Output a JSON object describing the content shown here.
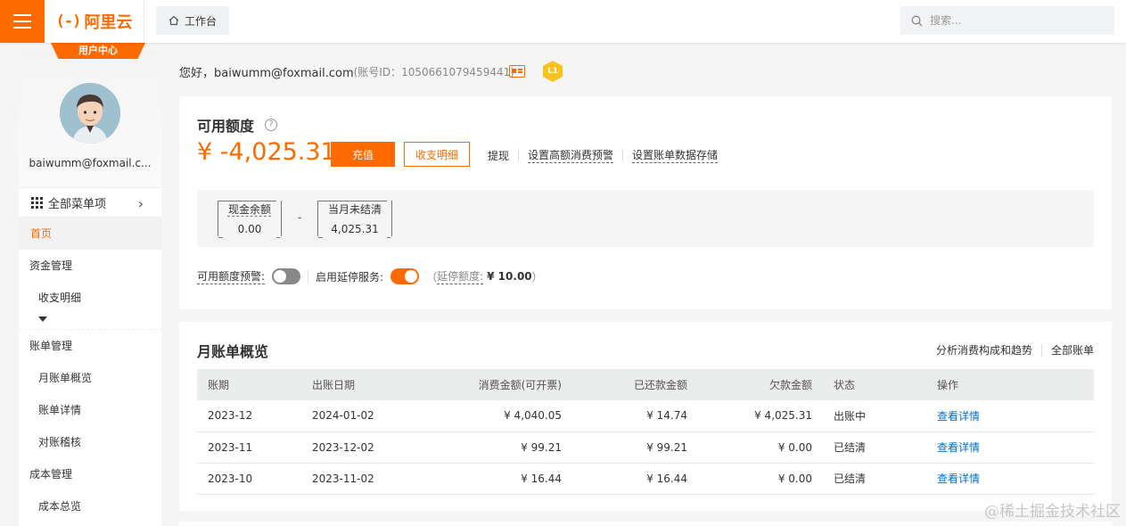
{
  "topbar": {
    "brand_mark": "(-)",
    "brand_name": "阿里云",
    "workbench_label": "工作台",
    "search_placeholder": "搜索..."
  },
  "sidebar": {
    "user_tag": "用户中心",
    "user_email": "baiwumm@foxmail.c...",
    "all_menu_label": "全部菜单项",
    "items": [
      {
        "type": "item",
        "label": "首页",
        "active": true
      },
      {
        "type": "group",
        "label": "资金管理"
      },
      {
        "type": "sub",
        "label": "收支明细"
      },
      {
        "type": "group",
        "label": "账单管理"
      },
      {
        "type": "sub",
        "label": "月账单概览"
      },
      {
        "type": "sub",
        "label": "账单详情"
      },
      {
        "type": "sub",
        "label": "对账稽核"
      },
      {
        "type": "group",
        "label": "成本管理"
      },
      {
        "type": "sub",
        "label": "成本总览"
      }
    ]
  },
  "greeting": {
    "hello": "您好，baiwumm@foxmail.com",
    "account_id": "(账号ID：1050661079459441)",
    "level": "L1"
  },
  "quota": {
    "title": "可用额度",
    "help": "?",
    "balance": "¥ -4,025.31",
    "recharge_label": "充值",
    "detail_label": "收支明细",
    "actions": [
      "提现",
      "设置高额消费预警",
      "设置账单数据存储"
    ],
    "cash_label": "现金余额",
    "cash_value": "0.00",
    "minus": "-",
    "unsettled_label": "当月未结清",
    "unsettled_value": "4,025.31",
    "alert_label": "可用额度预警:",
    "alert_on": false,
    "delay_label": "启用延停服务:",
    "delay_on": true,
    "delay_open": "（",
    "delay_quota_label": "延停额度:",
    "delay_quota_value": "¥ 10.00",
    "delay_close": "）"
  },
  "bills": {
    "title": "月账单概览",
    "links": [
      "分析消费构成和趋势",
      "全部账单"
    ],
    "columns": [
      "账期",
      "出账日期",
      "消费金额(可开票)",
      "已还款金额",
      "欠款金额",
      "状态",
      "操作"
    ],
    "rows": [
      {
        "period": "2023-12",
        "date": "2024-01-02",
        "amount": "¥ 4,040.05",
        "paid": "¥ 14.74",
        "owed": "¥ 4,025.31",
        "status": "出账中",
        "action": "查看详情"
      },
      {
        "period": "2023-11",
        "date": "2023-12-02",
        "amount": "¥ 99.21",
        "paid": "¥ 99.21",
        "owed": "¥ 0.00",
        "status": "已结清",
        "action": "查看详情"
      },
      {
        "period": "2023-10",
        "date": "2023-11-02",
        "amount": "¥ 16.44",
        "paid": "¥ 16.44",
        "owed": "¥ 0.00",
        "status": "已结清",
        "action": "查看详情"
      }
    ]
  },
  "watermark": "@稀土掘金技术社区",
  "colors": {
    "accent": "#ff6a00",
    "link": "#0070cc"
  }
}
